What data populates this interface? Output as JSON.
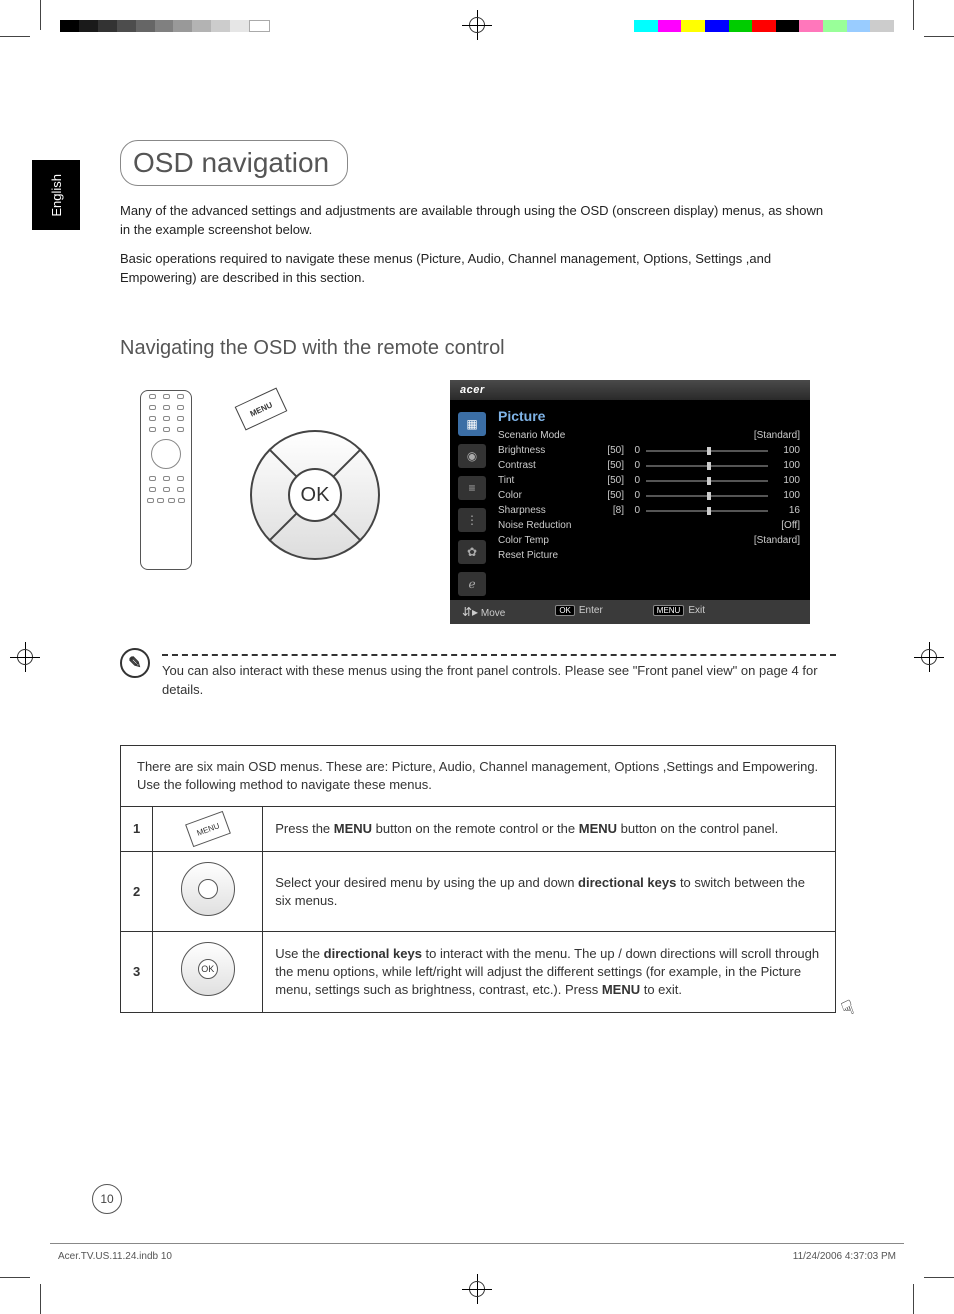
{
  "language_tab": "English",
  "title": "OSD navigation",
  "intro1": "Many of the advanced settings and adjustments are available through using the OSD (onscreen display) menus, as shown in the example screenshot below.",
  "intro2": "Basic operations required to navigate these menus (Picture, Audio, Channel management, Options, Settings ,and Empowering) are described in this section.",
  "subhead": "Navigating the OSD with the remote control",
  "remote": {
    "menu_label": "MENU",
    "ok_label": "OK"
  },
  "osd": {
    "brand": "acer",
    "menu_title": "Picture",
    "rows": [
      {
        "label": "Scenario Mode",
        "mode": "value",
        "value": "[Standard]"
      },
      {
        "label": "Brightness",
        "mode": "slider",
        "value": "[50]",
        "min": "0",
        "max": "100"
      },
      {
        "label": "Contrast",
        "mode": "slider",
        "value": "[50]",
        "min": "0",
        "max": "100"
      },
      {
        "label": "Tint",
        "mode": "slider",
        "value": "[50]",
        "min": "0",
        "max": "100"
      },
      {
        "label": "Color",
        "mode": "slider",
        "value": "[50]",
        "min": "0",
        "max": "100"
      },
      {
        "label": "Sharpness",
        "mode": "slider",
        "value": "[8]",
        "min": "0",
        "max": "16"
      },
      {
        "label": "Noise Reduction",
        "mode": "value",
        "value": "[Off]"
      },
      {
        "label": "Color Temp",
        "mode": "value",
        "value": "[Standard]"
      },
      {
        "label": "Reset Picture",
        "mode": "none"
      }
    ],
    "footer": {
      "move": "Move",
      "enter_key": "OK",
      "enter": "Enter",
      "exit_key": "MENU",
      "exit": "Exit"
    }
  },
  "note": "You can also interact with these menus using the front panel controls. Please see \"Front panel view\" on page 4 for details.",
  "steps": {
    "intro": "There are six main OSD menus. These are: Picture, Audio, Channel management, Options ,Settings and Empowering. Use the following method to navigate these menus.",
    "items": [
      {
        "num": "1",
        "html": "Press the <b>MENU</b> button on the remote control or the <b>MENU</b> button on the control panel."
      },
      {
        "num": "2",
        "html": "Select your desired menu by using the up and down <b>directional keys</b> to switch between the six menus."
      },
      {
        "num": "3",
        "html": "Use the <b>directional keys</b> to interact with the menu. The up / down directions will scroll through the menu options, while left/right will adjust the different settings (for example, in the Picture menu, settings such as brightness, contrast, etc.). Press <b>MENU</b> to exit."
      }
    ]
  },
  "page_number": "10",
  "footer_left": "Acer.TV.US.11.24.indb   10",
  "footer_right": "11/24/2006   4:37:03 PM"
}
